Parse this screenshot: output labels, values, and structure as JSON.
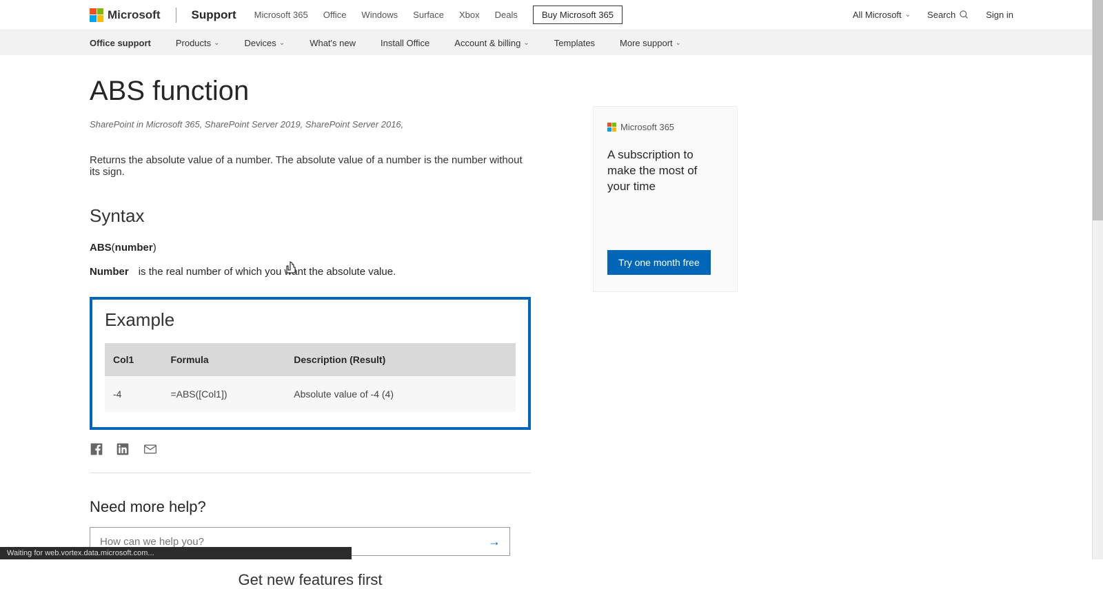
{
  "header": {
    "brand": "Microsoft",
    "support": "Support",
    "nav": [
      "Microsoft 365",
      "Office",
      "Windows",
      "Surface",
      "Xbox",
      "Deals"
    ],
    "buy": "Buy Microsoft 365",
    "all_ms": "All Microsoft",
    "search": "Search",
    "signin": "Sign in"
  },
  "subnav": {
    "items": [
      "Office support",
      "Products",
      "Devices",
      "What's new",
      "Install Office",
      "Account & billing",
      "Templates",
      "More support"
    ],
    "has_dropdown": [
      false,
      true,
      true,
      false,
      false,
      true,
      false,
      true
    ]
  },
  "main": {
    "title": "ABS function",
    "applies_to": "SharePoint in Microsoft 365, SharePoint Server 2019, SharePoint Server 2016,",
    "intro": "Returns the absolute value of a number. The absolute value of a number is the number without its sign.",
    "syntax_heading": "Syntax",
    "syntax_func": "ABS",
    "syntax_open": "(",
    "syntax_arg": "number",
    "syntax_close": ")",
    "param_name": "Number",
    "param_desc": "is the real number of which you want the absolute value.",
    "example_heading": "Example",
    "table": {
      "headers": [
        "Col1",
        "Formula",
        "Description (Result)"
      ],
      "row": [
        "-4",
        "=ABS([Col1])",
        "Absolute value of -4 (4)"
      ]
    },
    "nmh": "Need more help?",
    "search_placeholder": "How can we help you?",
    "gnf": "Get new features first"
  },
  "promo": {
    "brand": "Microsoft 365",
    "text": "A subscription to make the most of your time",
    "cta": "Try one month free"
  },
  "status": "Waiting for web.vortex.data.microsoft.com..."
}
